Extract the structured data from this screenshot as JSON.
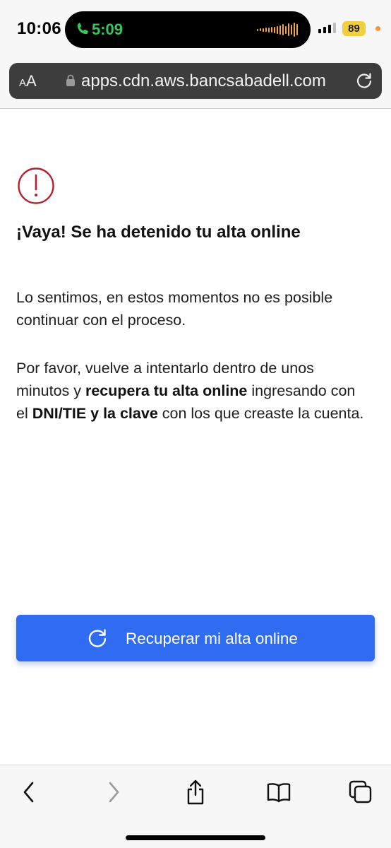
{
  "status_bar": {
    "time": "10:06",
    "call_time": "5:09",
    "battery": "89"
  },
  "browser": {
    "text_size_label_small": "A",
    "text_size_label_large": "A",
    "url": "apps.cdn.aws.bancsabadell.com"
  },
  "content": {
    "title": "¡Vaya! Se ha detenido tu alta online",
    "paragraph1": "Lo sentimos, en estos momentos no es posible continuar con el proceso.",
    "paragraph2": {
      "part1": "Por favor, vuelve a intentarlo dentro de unos minutos y ",
      "bold1": "recupera tu alta online",
      "part2": " ingresando con el ",
      "bold2": "DNI/TIE y la clave",
      "part3": " con los que creaste la cuenta."
    },
    "button_label": "Recuperar mi alta online"
  },
  "icons": {
    "alert": "alert-circle-icon",
    "reload": "reload-icon",
    "lock": "lock-icon",
    "call": "phone-icon",
    "back": "chevron-left-icon",
    "forward": "chevron-right-icon",
    "share": "share-icon",
    "bookmarks": "book-icon",
    "tabs": "tabs-icon"
  },
  "colors": {
    "primary_button": "#2f6cf2",
    "alert_red": "#b3202e",
    "call_green": "#34c759",
    "battery_yellow": "#f2cf3d"
  }
}
